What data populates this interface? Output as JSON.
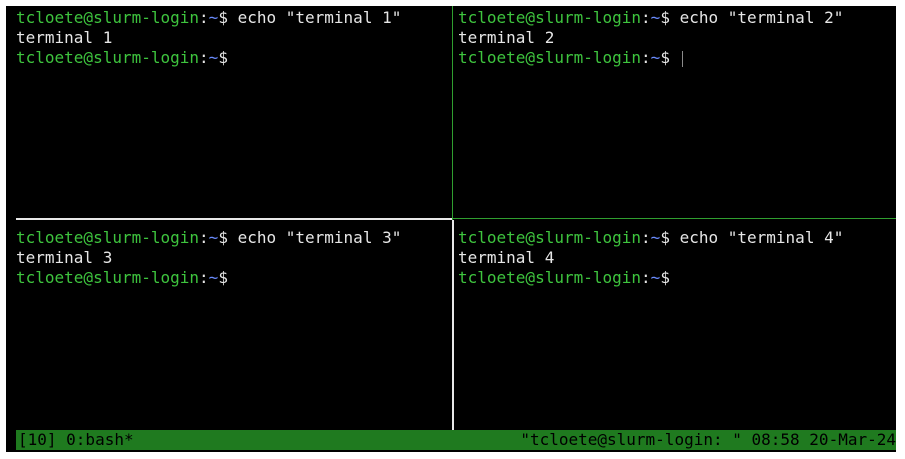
{
  "colors": {
    "background": "#000000",
    "prompt_user": "#3ec43e",
    "prompt_path": "#6b8cff",
    "text": "#e6e6e6",
    "active_border": "#2f9e2f",
    "inactive_border": "#e8e8e8",
    "status_bar": "#1f7a1f"
  },
  "prompt": {
    "user_host": "tcloete@slurm-login",
    "colon": ":",
    "path": "~",
    "dollar": "$"
  },
  "panes": [
    {
      "command": " echo \"terminal 1\"",
      "output": "terminal 1"
    },
    {
      "command": " echo \"terminal 2\"",
      "output": "terminal 2"
    },
    {
      "command": " echo \"terminal 3\"",
      "output": "terminal 3"
    },
    {
      "command": " echo \"terminal 4\"",
      "output": "terminal 4"
    }
  ],
  "status_bar": {
    "left": "[10] 0:bash*",
    "right": "\"tcloete@slurm-login: \" 08:58 20-Mar-24"
  }
}
